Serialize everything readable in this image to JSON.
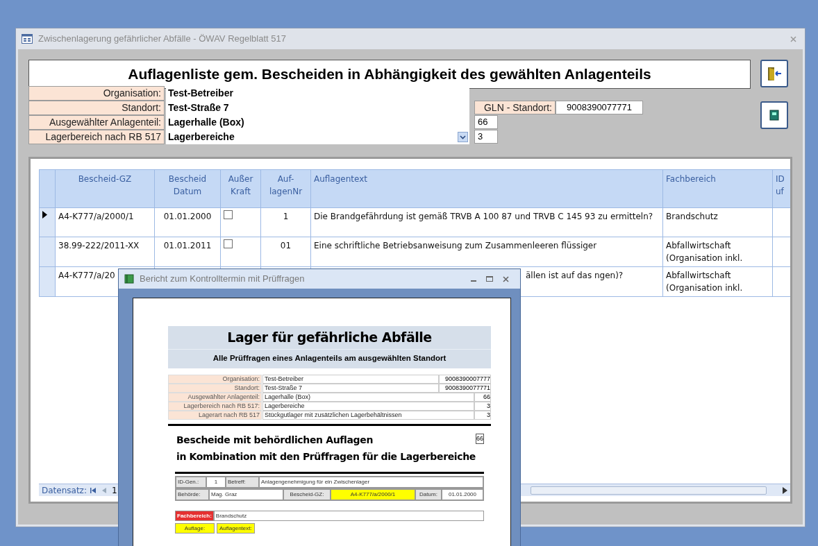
{
  "window": {
    "title": "Zwischenlagerung gefährlicher Abfälle - ÖWAV Regelblatt 517"
  },
  "header": {
    "title": "Auflagenliste gem. Bescheiden in Abhängigkeit des gewählten Anlagenteils"
  },
  "fields": [
    {
      "label": "Organisation:",
      "value": "Test-Betreiber",
      "kind": "text"
    },
    {
      "label": "Standort:",
      "value": "Test-Straße 7",
      "kind": "text"
    },
    {
      "label": "Ausgewählter Anlagenteil:",
      "value": "Lagerhalle (Box)",
      "kind": "text"
    },
    {
      "label": "Lagerbereich nach RB 517",
      "value": "Lagerbereiche",
      "kind": "dropdown"
    }
  ],
  "gln": {
    "label": "GLN - Standort:",
    "value": "9008390077771"
  },
  "counts": [
    "66",
    "3"
  ],
  "table": {
    "columns": [
      "Bescheid-GZ",
      "Bescheid Datum",
      "Außer Kraft",
      "Auf-lagenNr",
      "Auflagentext",
      "Fachbereich",
      "ID uf"
    ],
    "rows": [
      {
        "current": true,
        "covered": false,
        "gz": "A4-K777/a/2000/1",
        "datum": "01.01.2000",
        "ausser_kraft": false,
        "nr": "1",
        "text": "Die Brandgefährdung ist gemäß TRVB A 100 87 und TRVB C 145 93 zu ermitteln?",
        "fachbereich": "Brandschutz"
      },
      {
        "current": false,
        "covered": false,
        "gz": "38.99-222/2011-XX",
        "datum": "01.01.2011",
        "ausser_kraft": false,
        "nr": "01",
        "text": "Eine schriftliche Betriebsanweisung zum Zusammenleeren flüssiger",
        "fachbereich": "Abfallwirtschaft (Organisation inkl."
      },
      {
        "current": false,
        "covered": true,
        "gz": "A4-K777/a/20",
        "text": "ällen ist auf das ngen)?",
        "fachbereich": "Abfallwirtschaft (Organisation inkl."
      }
    ]
  },
  "record_nav": {
    "label": "Datensatz:",
    "value": "1"
  },
  "report_window": {
    "title": "Bericht zum Kontrolltermin mit Prüffragen",
    "report": {
      "title": "Lager für gefährliche Abfälle",
      "subtitle": "Alle Prüffragen eines Anlagenteils am ausgewählten Standort",
      "info_rows": [
        {
          "label": "Organisation:",
          "value": "Test-Betreiber",
          "extra": "9008390007777"
        },
        {
          "label": "Standort:",
          "value": "Test-Straße 7",
          "extra": "9008390077771"
        },
        {
          "label": "Ausgewählter Anlagenteil:",
          "value": "Lagerhalle (Box)",
          "extra": "66"
        },
        {
          "label": "Lagerbereich nach RB 517:",
          "value": "Lagerbereiche",
          "extra": "3"
        },
        {
          "label": "Lagerart nach RB 517",
          "value": "Stückgutlager mit zusätzlichen Lagerbehältnissen",
          "extra": "3"
        }
      ],
      "heading_lines": [
        "Bescheide mit behördlichen Auflagen",
        "in Kombination mit den Prüffragen für die Lagerbereiche"
      ],
      "heading_badge": "66",
      "bescheid": {
        "id_label": "ID-Gen.:",
        "id": "1",
        "betreff_label": "Betreff:",
        "betreff": "Anlagengenehmigung für ein Zwischenlager",
        "behoerde_label": "Behörde:",
        "behoerde": "Mag. Graz",
        "gz_label": "Bescheid-GZ:",
        "gz": "A4-K777/a/2000/1",
        "datum_label": "Datum:",
        "datum": "01.01.2000"
      },
      "fachbereich_label": "Fachbereich:",
      "fachbereich": "Brandschutz",
      "auflage_label": "Auflage:",
      "auflagentext_label": "Auflagentext:"
    }
  }
}
